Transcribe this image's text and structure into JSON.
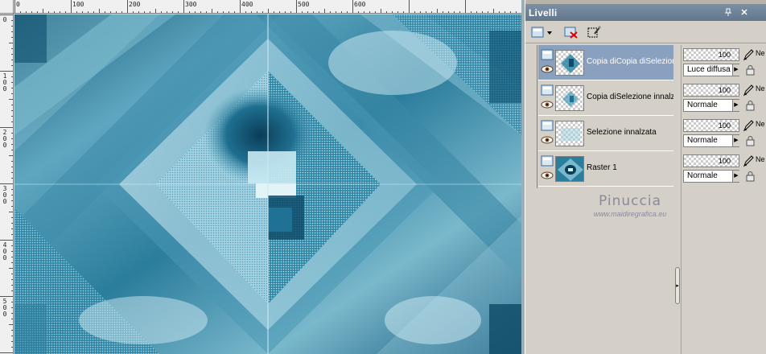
{
  "ruler": {
    "top_labels": [
      "0",
      "100",
      "200",
      "300",
      "400",
      "500",
      "600"
    ],
    "left_labels": [
      "0",
      "100",
      "200",
      "300",
      "400",
      "500"
    ]
  },
  "panel": {
    "title": "Livelli",
    "pin_icon": "pin-icon",
    "close_icon": "close-icon",
    "toolbar": [
      {
        "icon": "new-layer-icon",
        "label": "Nuovo livello"
      },
      {
        "icon": "delete-layer-icon",
        "label": "Elimina"
      },
      {
        "icon": "selection-icon",
        "label": "Selezione"
      }
    ]
  },
  "layers": [
    {
      "name": "Copia diCopia diSelezione",
      "opacity": "100",
      "blend": "Luce diffusa",
      "blend_prefix": "Ne",
      "selected": true
    },
    {
      "name": "Copia diSelezione innalzat",
      "opacity": "100",
      "blend": "Normale",
      "blend_prefix": "Ne",
      "selected": false
    },
    {
      "name": "Selezione innalzata",
      "opacity": "100",
      "blend": "Normale",
      "blend_prefix": "Ne",
      "selected": false
    },
    {
      "name": "Raster 1",
      "opacity": "100",
      "blend": "Normale",
      "blend_prefix": "Ne",
      "selected": false
    }
  ],
  "watermark": {
    "name": "Pinuccia",
    "url": "www.maidiregrafica.eu"
  },
  "colors": {
    "selected_row": "#8aa0bf",
    "panel_bg": "#d4d0c8",
    "canvas_teal": "#2b7d9c",
    "canvas_light": "#c8e6f0",
    "canvas_dark": "#0d4460"
  }
}
